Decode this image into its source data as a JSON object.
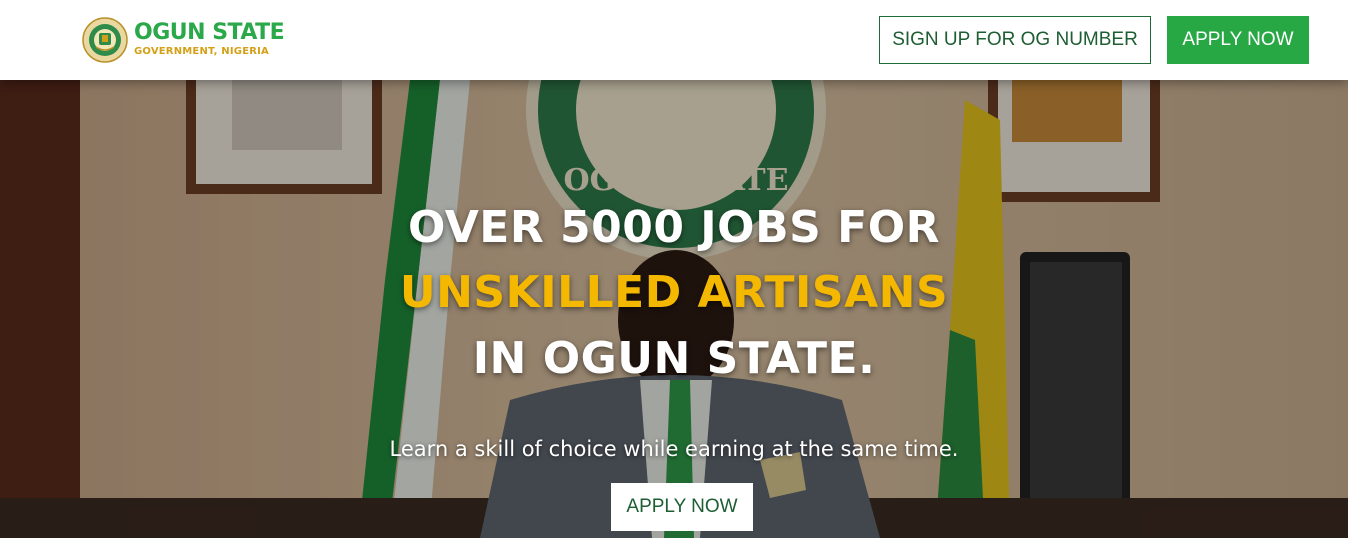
{
  "header": {
    "logo_title": "OGUN STATE",
    "logo_subtitle": "GOVERNMENT, NIGERIA",
    "signup_button": "SIGN UP FOR OG NUMBER",
    "apply_button": "APPLY NOW"
  },
  "hero": {
    "headline_line1": "OVER 5000 JOBS FOR",
    "headline_line2": "UNSKILLED ARTISANS",
    "headline_line3": "IN OGUN STATE.",
    "tagline": "Learn a skill of choice while earning at the same time.",
    "cta_button": "APPLY NOW",
    "seal_text": "OGUN STATE"
  },
  "colors": {
    "brand_green": "#28a745",
    "accent_yellow": "#f5b800",
    "logo_gold": "#d4a017"
  }
}
